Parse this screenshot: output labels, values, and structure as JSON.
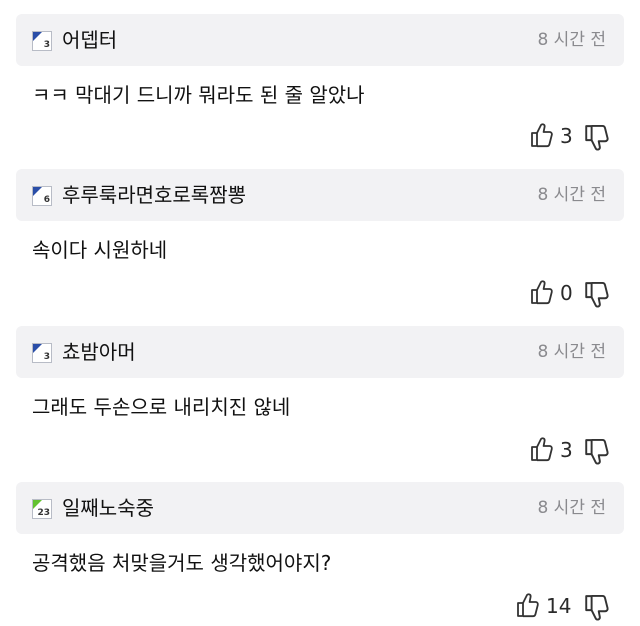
{
  "comments": [
    {
      "level": "3",
      "author": "어뎁터",
      "time": "8 시간 전",
      "text": "ㅋㅋ 막대기 드니까 뭐라도 된 줄 알았나",
      "likes": "3"
    },
    {
      "level": "6",
      "author": "후루룩라면호로록짬뽕",
      "time": "8 시간 전",
      "text": "속이다 시원하네",
      "likes": "0"
    },
    {
      "level": "3",
      "author": "쵸밤아머",
      "time": "8 시간 전",
      "text": "그래도 두손으로 내리치진 않네",
      "likes": "3"
    },
    {
      "level": "23",
      "author": "일째노숙중",
      "time": "8 시간 전",
      "text": "공격했음 처맞을거도 생각했어야지?",
      "likes": "14"
    }
  ],
  "icons": {
    "like": "thumbs-up-outline",
    "dislike": "thumbs-down-outline"
  },
  "colors": {
    "header_bg": "#f2f2f4",
    "level_badge_blue": "#2a4ea8",
    "level_badge_green": "#62c22f",
    "time_text": "#8a8a8e"
  }
}
